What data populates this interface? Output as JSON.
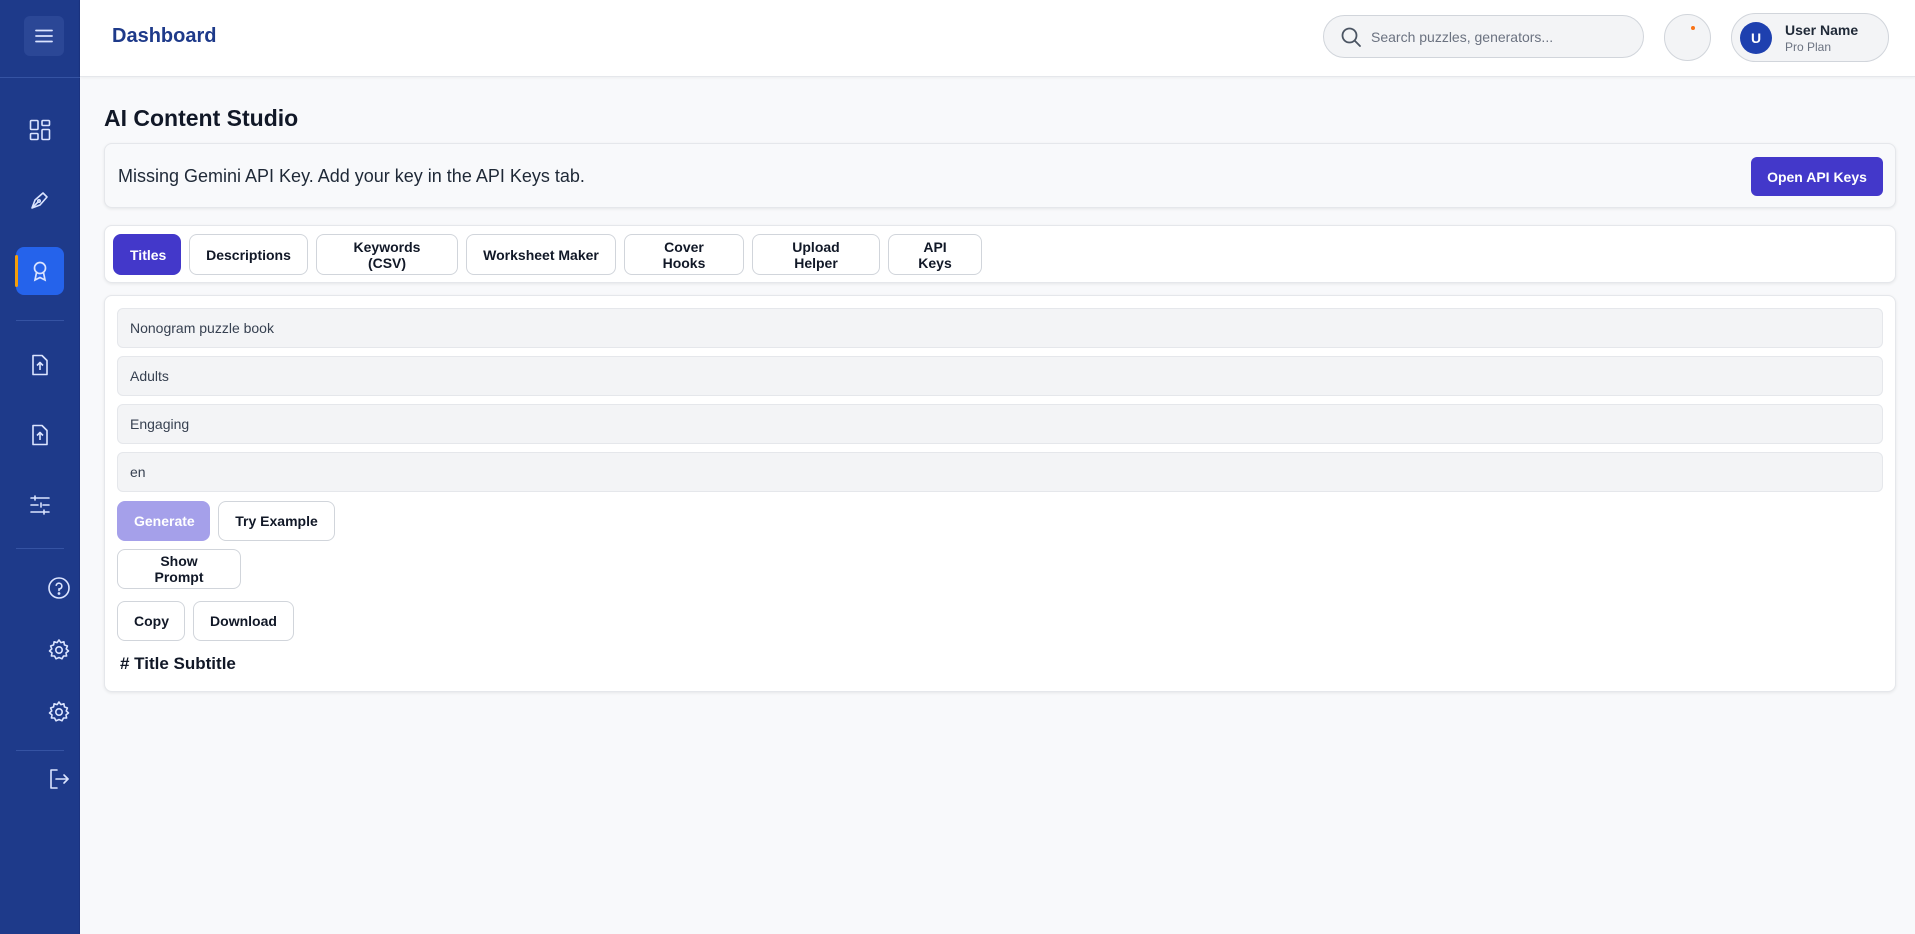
{
  "header": {
    "title": "Dashboard",
    "search_placeholder": "Search puzzles, generators...",
    "user": {
      "avatar_initial": "U",
      "name": "User Name",
      "plan": "Pro Plan"
    }
  },
  "sidebar": {
    "items": [
      {
        "icon": "grid-icon"
      },
      {
        "icon": "pen-tool-icon"
      },
      {
        "icon": "award-icon",
        "active": true
      },
      {
        "icon": "file-upload-icon"
      },
      {
        "icon": "file-upload-icon"
      },
      {
        "icon": "sliders-icon"
      },
      {
        "icon": "help-circle-icon"
      },
      {
        "icon": "settings-icon"
      },
      {
        "icon": "settings-icon"
      },
      {
        "icon": "logout-icon"
      }
    ]
  },
  "main": {
    "page_title": "AI Content Studio",
    "alert": {
      "message": "Missing Gemini API Key. Add your key in the API Keys tab.",
      "button": "Open API Keys"
    },
    "tabs": [
      "Titles",
      "Descriptions",
      "Keywords (CSV)",
      "Worksheet Maker",
      "Cover Hooks",
      "Upload Helper",
      "API Keys"
    ],
    "active_tab": "Titles",
    "form": {
      "topic": "Nonogram puzzle book",
      "audience": "Adults",
      "tone": "Engaging",
      "language": "en"
    },
    "buttons": {
      "generate": "Generate",
      "try_example": "Try Example",
      "show_prompt": "Show Prompt",
      "copy": "Copy",
      "download": "Download"
    },
    "result_heading": "# Title Subtitle"
  },
  "colors": {
    "sidebar": "#1e3a8a",
    "primary": "#4338ca",
    "active_item": "#2563eb",
    "accent": "#f59e0b"
  }
}
